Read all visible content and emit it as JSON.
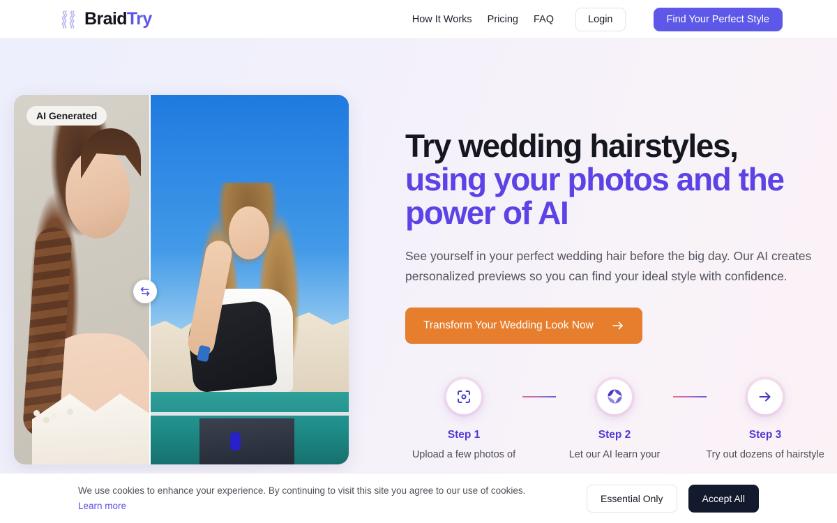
{
  "header": {
    "logo_icon": "braid-strands-icon",
    "brand_part1": "Braid",
    "brand_part2": "Try",
    "nav": [
      {
        "label": "How It Works"
      },
      {
        "label": "Pricing"
      },
      {
        "label": "FAQ"
      }
    ],
    "login_label": "Login",
    "cta_label": "Find Your Perfect Style"
  },
  "hero": {
    "comparison": {
      "badge": "AI Generated",
      "handle_icon": "swap-horizontal-arrows-icon",
      "left_alt": "AI generated bride with braided wedding hairstyle",
      "right_alt": "Original photo of woman on seaside terrace"
    },
    "headline_line1": "Try wedding hairstyles,",
    "headline_line2": "using your photos and the",
    "headline_line3": "power of AI",
    "subhead": "See yourself in your perfect wedding hair before the big day. Our AI creates personalized previews so you can find your ideal style with confidence.",
    "cta_label": "Transform Your Wedding Look Now",
    "cta_icon": "arrow-right-icon",
    "steps": [
      {
        "icon": "scan-focus-icon",
        "label": "Step 1",
        "desc": "Upload a few photos of"
      },
      {
        "icon": "ai-spiral-icon",
        "label": "Step 2",
        "desc": "Let our AI learn your"
      },
      {
        "icon": "arrow-right-icon",
        "label": "Step 3",
        "desc": "Try out dozens of hairstyle"
      }
    ]
  },
  "cookie_banner": {
    "message": "We use cookies to enhance your experience. By continuing to visit this site you agree to our use of cookies.",
    "link_label": "Learn more",
    "essential_label": "Essential Only",
    "accept_label": "Accept All"
  },
  "colors": {
    "accent_purple": "#5d58e8",
    "headline_accent": "#5d42e5",
    "cta_orange": "#e67e2e",
    "accept_dark": "#141a2e",
    "step_label": "#4f37d4"
  }
}
